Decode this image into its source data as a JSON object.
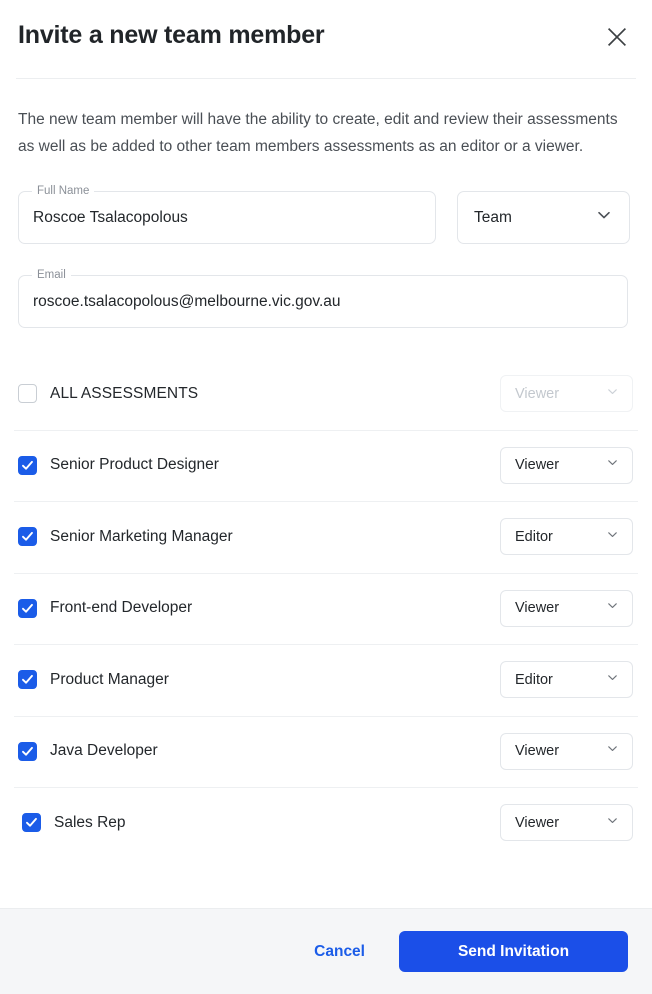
{
  "dialog": {
    "title": "Invite a new team member",
    "close_icon": "close-icon",
    "description": "The new team member will have the ability to create, edit and review their assessments as well as be added to other team members assessments as an editor or a viewer."
  },
  "form": {
    "full_name": {
      "label": "Full Name",
      "value": "Roscoe Tsalacopolous",
      "placeholder": "Full Name"
    },
    "team": {
      "value": "Team",
      "chevron_icon": "chevron-down-icon"
    },
    "email": {
      "label": "Email",
      "value": "roscoe.tsalacopolous@melbourne.vic.gov.au",
      "placeholder": "Email"
    }
  },
  "assessments": [
    {
      "label": "ALL ASSESSMENTS",
      "checked": false,
      "role": "Viewer",
      "disabled": true,
      "indented": false
    },
    {
      "label": "Senior Product Designer",
      "checked": true,
      "role": "Viewer",
      "disabled": false,
      "indented": false
    },
    {
      "label": "Senior Marketing Manager",
      "checked": true,
      "role": "Editor",
      "disabled": false,
      "indented": false
    },
    {
      "label": "Front-end Developer",
      "checked": true,
      "role": "Viewer",
      "disabled": false,
      "indented": false
    },
    {
      "label": "Product Manager",
      "checked": true,
      "role": "Editor",
      "disabled": false,
      "indented": false
    },
    {
      "label": "Java Developer",
      "checked": true,
      "role": "Viewer",
      "disabled": false,
      "indented": false
    },
    {
      "label": "Sales Rep",
      "checked": true,
      "role": "Viewer",
      "disabled": false,
      "indented": true
    }
  ],
  "footer": {
    "cancel_label": "Cancel",
    "send_label": "Send Invitation"
  },
  "colors": {
    "accent_blue": "#1b5ce8",
    "button_blue": "#1b4fe8",
    "text_primary": "#23272b",
    "text_secondary": "#4a4f55",
    "label_grey": "#8b9098",
    "border_grey": "#e3e6ea",
    "divider": "#eef0f2",
    "footer_bg": "#f5f6f8",
    "disabled_text": "#c3c8ce"
  }
}
